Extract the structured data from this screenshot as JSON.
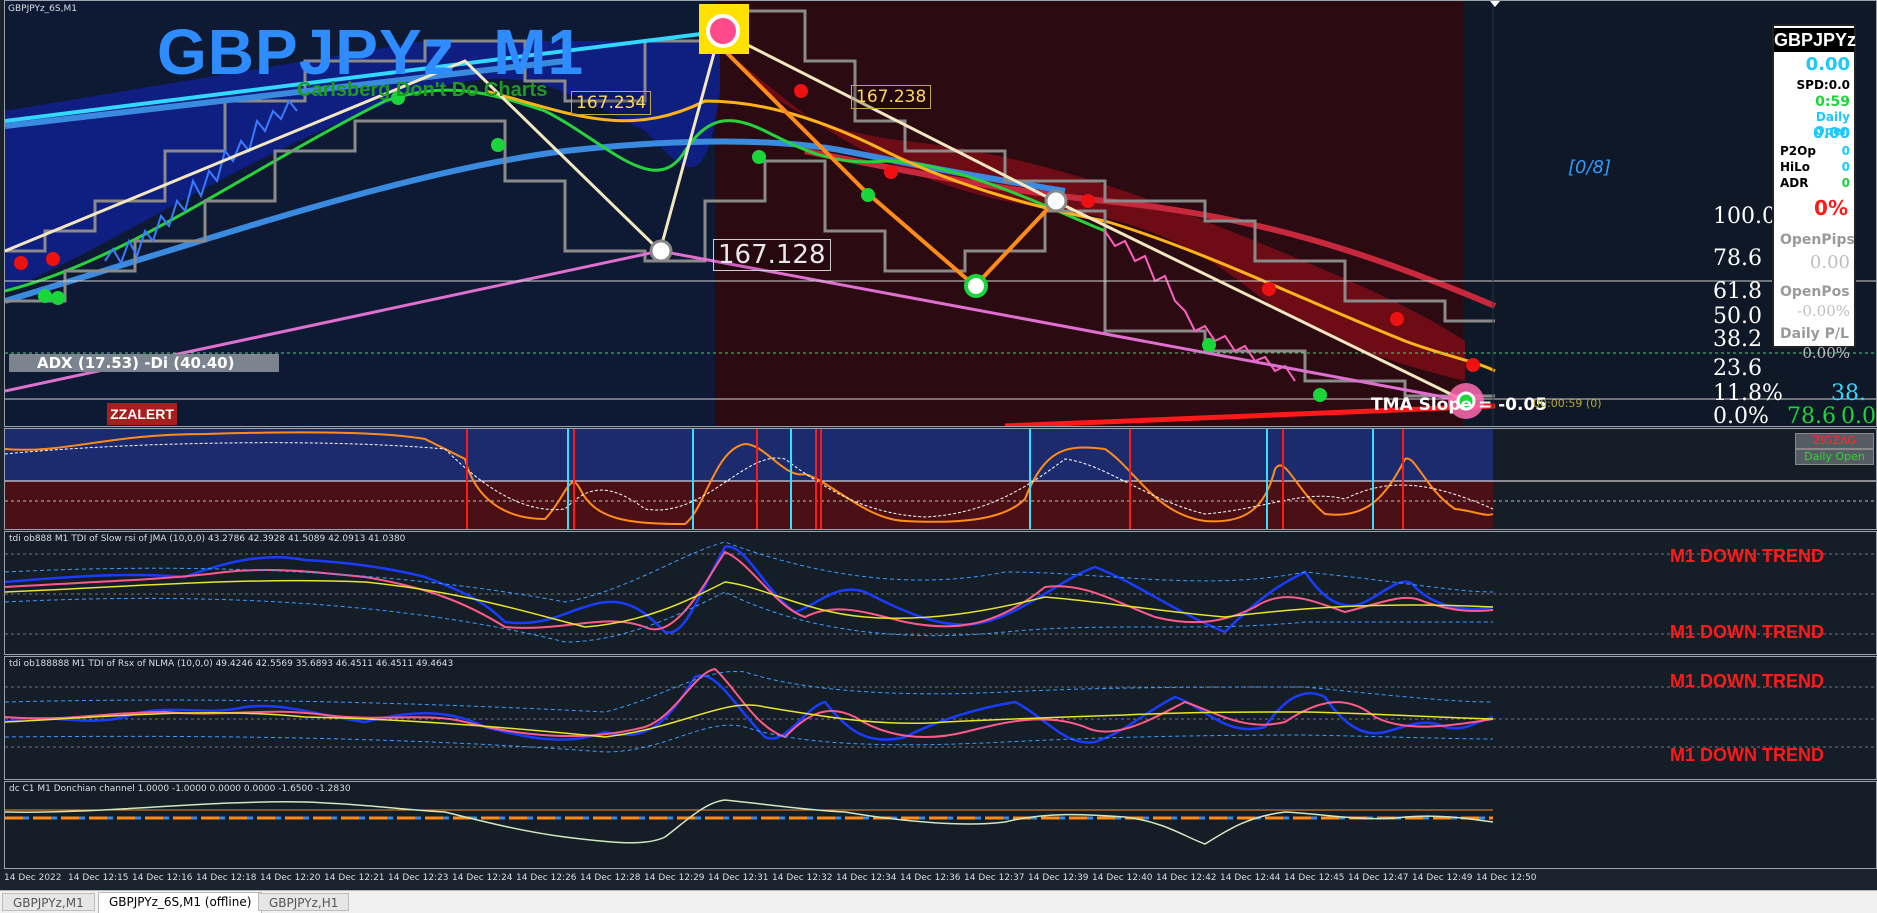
{
  "window": {
    "title": "GBPJPYz_6S,M1"
  },
  "main": {
    "symbol_title": "GBPJPYz  M1",
    "subtitle": "Carlsberg Don't Do Charts",
    "zz_price_1": "167.234",
    "zz_price_2": "167.238",
    "zz_price_3": "167.128",
    "adx_text": "ADX (17.53)  -Di (40.40)",
    "zzalert": "ZZALERT",
    "tma_slope": "TMA Slope = -0.05",
    "timer_text": "00:00:59 (0)",
    "count_label": "[0/8]",
    "fib_levels": [
      "100.0",
      "78.6",
      "61.8",
      "50.0",
      "38.2",
      "23.6",
      "11.8%",
      "0.0%"
    ],
    "fib_partial_right": [
      "78.6",
      "38.",
      "0.0"
    ],
    "colors": {
      "bull_area": "#0a1a6e",
      "bear_area": "#5a0a0f",
      "zigzag": "#ffffff",
      "channel": "#8a8a8a",
      "tma": "#3a8be0",
      "trendline": "#e070d0"
    }
  },
  "side_panel": {
    "symbol": "GBPJPYz",
    "spread_value": "0.00",
    "spd": "SPD:0.0",
    "timer": "0:59",
    "daily_open_label": "Daily Open",
    "daily_open_value": "0.00",
    "p2op_label": "P2Op",
    "p2op_value": "0",
    "hilo_label": "HiLo",
    "hilo_value": "0",
    "adr_label": "ADR",
    "adr_value": "0",
    "percent": "0%",
    "openpips_label": "OpenPips",
    "openpips_value": "0.00",
    "openpos_label": "OpenPos",
    "openpos_value": "-0.00%",
    "dailypl_label": "Daily P/L",
    "dailypl_value": "0.00%"
  },
  "pane2": {
    "zigzag_btn": "ZIGZAG",
    "daily_open_btn": "Daily Open"
  },
  "pane3": {
    "title": "tdi ob888 M1 TDI of Slow rsi of JMA (10,0,0) 43.2786 42.3928 41.5089 42.0913 41.0380",
    "trend_top": "M1 DOWN TREND",
    "trend_bottom": "M1 DOWN TREND"
  },
  "pane4": {
    "title": "tdi ob188888 M1 TDI of Rsx of NLMA (10,0,0) 49.4246 42.5569 35.6893 46.4511 46.4511 49.4643",
    "trend_top": "M1 DOWN TREND",
    "trend_bottom": "M1 DOWN TREND"
  },
  "pane5": {
    "title": "dc C1 M1 Donchian channel 1.0000 -1.0000 0.0000 0.0000 -1.6500 -1.2830"
  },
  "time_axis": [
    "14 Dec 2022",
    "14 Dec 12:15",
    "14 Dec 12:16",
    "14 Dec 12:18",
    "14 Dec 12:20",
    "14 Dec 12:21",
    "14 Dec 12:23",
    "14 Dec 12:24",
    "14 Dec 12:26",
    "14 Dec 12:28",
    "14 Dec 12:29",
    "14 Dec 12:31",
    "14 Dec 12:32",
    "14 Dec 12:34",
    "14 Dec 12:36",
    "14 Dec 12:37",
    "14 Dec 12:39",
    "14 Dec 12:40",
    "14 Dec 12:42",
    "14 Dec 12:44",
    "14 Dec 12:45",
    "14 Dec 12:47",
    "14 Dec 12:49",
    "14 Dec 12:50"
  ],
  "tabs": [
    "GBPJPYz,M1",
    "GBPJPYz_6S,M1 (offline)",
    "GBPJPYz,H1"
  ]
}
